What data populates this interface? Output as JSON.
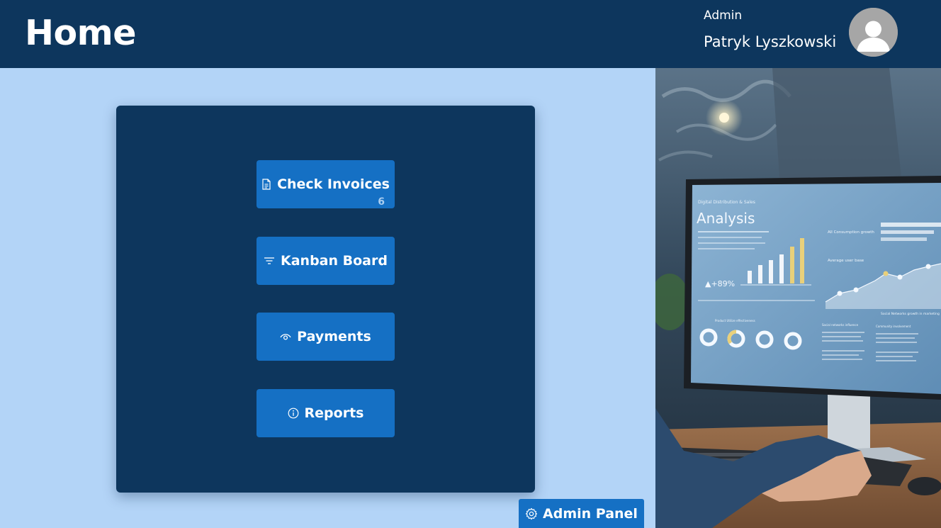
{
  "header": {
    "title": "Home",
    "user_role": "Admin",
    "user_name": "Patryk Lyszkowski",
    "avatar_icon": "user-avatar-icon"
  },
  "menu": {
    "items": [
      {
        "label": "Check Invoices",
        "icon": "document-icon",
        "badge": "6"
      },
      {
        "label": "Kanban Board",
        "icon": "filter-icon"
      },
      {
        "label": "Payments",
        "icon": "eye-icon"
      },
      {
        "label": "Reports",
        "icon": "info-icon"
      }
    ]
  },
  "admin_panel": {
    "label": "Admin Panel",
    "icon": "gear-icon"
  },
  "hero": {
    "subtitle": "Digital Distribution & Sales",
    "title": "Analysis",
    "growth": "▲+89%",
    "panel_consumption": "All Consumption growth",
    "panel_users": "Average user base",
    "panel_social": "Social Networks growth in marketing",
    "panel_effectiveness": "Product Utilize effectiveness",
    "panel_influence": "Social networks influence",
    "panel_involvement": "Community involvement"
  },
  "colors": {
    "header_bg": "#0d365d",
    "page_bg": "#b3d4f7",
    "card_bg": "#0d365d",
    "button_bg": "#1570c4",
    "badge_text": "#a9cdf0"
  }
}
